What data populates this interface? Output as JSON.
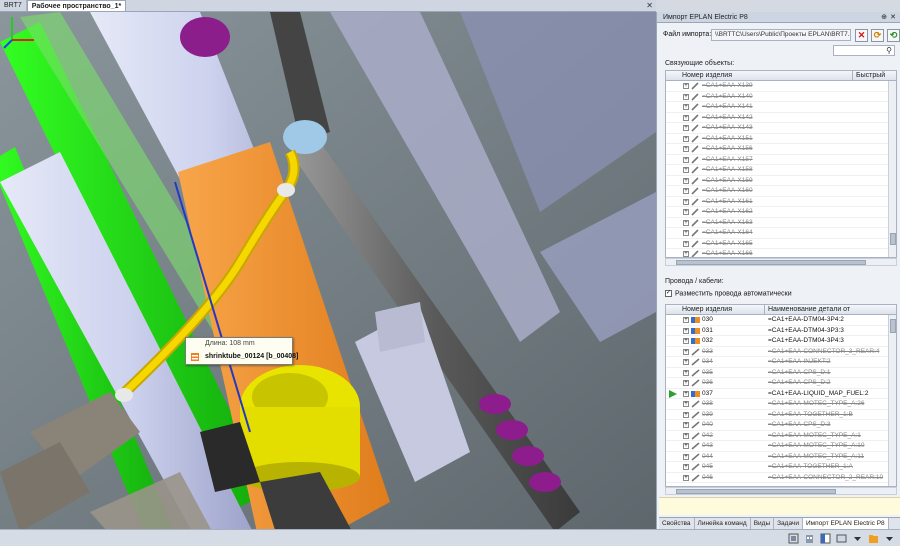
{
  "tabs": [
    {
      "label": "BRT7"
    },
    {
      "label": "Рабочее пространство_1*"
    }
  ],
  "tooltip": {
    "length": "Длина: 108 mm",
    "name": "shrinktube_00124 [b_00408]"
  },
  "panel": {
    "title": "Импорт EPLAN Electric P8",
    "file_label": "Файл импорта:",
    "file_path": "\\\\BRTTC\\Users\\Public\\Проекты EPLAN\\BRT7.e",
    "linked_label": "Связующие объекты:",
    "linked_headers": [
      "Номер изделия",
      "Быстрый"
    ],
    "linked_rows": [
      "=CA1+EAA-X139",
      "=CA1+EAA-X140",
      "=CA1+EAA-X141",
      "=CA1+EAA-X142",
      "=CA1+EAA-X143",
      "=CA1+EAA-X151",
      "=CA1+EAA-X156",
      "=CA1+EAA-X157",
      "=CA1+EAA-X158",
      "=CA1+EAA-X159",
      "=CA1+EAA-X160",
      "=CA1+EAA-X161",
      "=CA1+EAA-X162",
      "=CA1+EAA-X163",
      "=CA1+EAA-X164",
      "=CA1+EAA-X165",
      "=CA1+EAA-X166"
    ],
    "wires_label": "Провода / кабели:",
    "auto_place_label": "Разместить провода автоматически",
    "wires_headers": [
      "Номер изделия",
      "Наименование детали от"
    ],
    "wires_rows": [
      {
        "num": "030",
        "name": "=CA1+EAA-DTM04-3P4:2",
        "active": true,
        "arrow": false
      },
      {
        "num": "031",
        "name": "=CA1+EAA-DTM04-3P3:3",
        "active": true,
        "arrow": false
      },
      {
        "num": "032",
        "name": "=CA1+EAA-DTM04-3P4:3",
        "active": true,
        "arrow": false
      },
      {
        "num": "033",
        "name": "=CA1+EAA-CONNECTOR_3_REAR:4",
        "active": false,
        "arrow": false
      },
      {
        "num": "034",
        "name": "=CA1+EAA-INJEKT:2",
        "active": false,
        "arrow": false
      },
      {
        "num": "035",
        "name": "=CA1+EAA-CPS_D:1",
        "active": false,
        "arrow": false
      },
      {
        "num": "036",
        "name": "=CA1+EAA-CPS_D:2",
        "active": false,
        "arrow": false
      },
      {
        "num": "037",
        "name": "=CA1+EAA-LIQUID_MAP_FUEL:2",
        "active": true,
        "arrow": true
      },
      {
        "num": "038",
        "name": "=CA1+EAA-MOTEC_TYPE_A:26",
        "active": false,
        "arrow": false
      },
      {
        "num": "039",
        "name": "=CA1+EAA-TOGETHER_1:B",
        "active": false,
        "arrow": false
      },
      {
        "num": "040",
        "name": "=CA1+EAA-CPS_D:3",
        "active": false,
        "arrow": false
      },
      {
        "num": "042",
        "name": "=CA1+EAA-MOTEC_TYPE_A:1",
        "active": false,
        "arrow": false
      },
      {
        "num": "043",
        "name": "=CA1+EAA-MOTEC_TYPE_A:10",
        "active": false,
        "arrow": false
      },
      {
        "num": "044",
        "name": "=CA1+EAA-MOTEC_TYPE_A:11",
        "active": false,
        "arrow": false
      },
      {
        "num": "045",
        "name": "=CA1+EAA-TOGETHER_1:A",
        "active": false,
        "arrow": false
      },
      {
        "num": "046",
        "name": "=CA1+EAA-CONNECTOR_2_REAR:10",
        "active": false,
        "arrow": false
      }
    ]
  },
  "bottom_tabs": [
    {
      "label": "Свойства"
    },
    {
      "label": "Линейка команд"
    },
    {
      "label": "Виды"
    },
    {
      "label": "Задачи"
    },
    {
      "label": "Импорт EPLAN Electric P8"
    }
  ],
  "colors": {
    "accent_green": "#2ea02e",
    "cable_yellow": "#f2d000",
    "tube_orange": "#f59a3c",
    "frame_green": "#22e01a"
  }
}
